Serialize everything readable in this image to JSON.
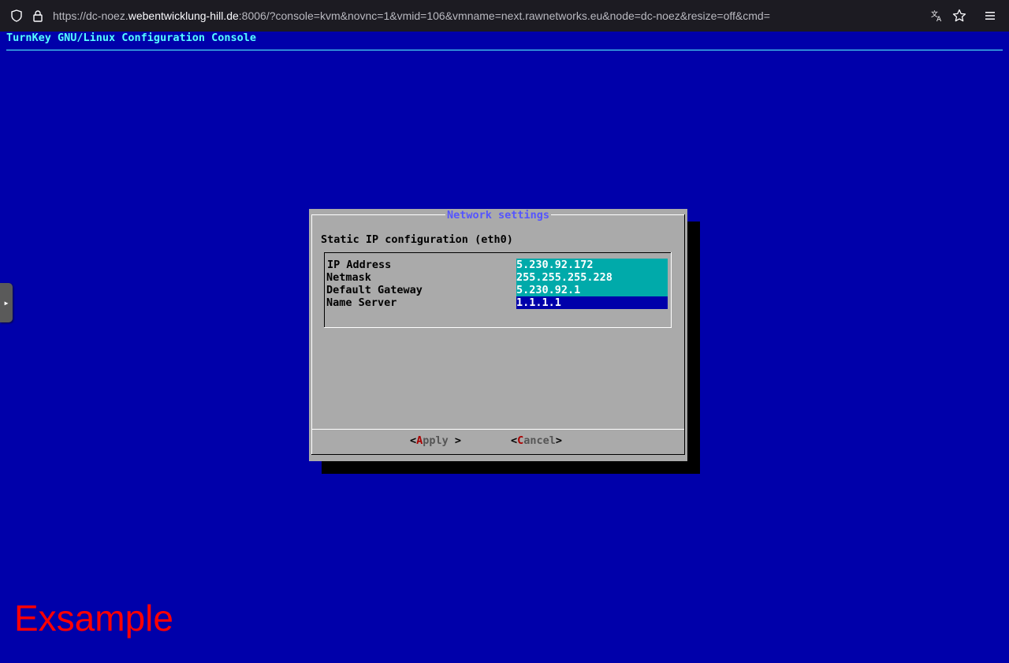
{
  "browser": {
    "url_prefix": "https://dc-noez.",
    "url_host": "webentwicklung-hill.de",
    "url_suffix": ":8006/?console=kvm&novnc=1&vmid=106&vmname=next.rawnetworks.eu&node=dc-noez&resize=off&cmd="
  },
  "console": {
    "title": "TurnKey GNU/Linux Configuration Console"
  },
  "dialog": {
    "title": "Network settings",
    "subtitle": "Static IP configuration (eth0)",
    "fields": [
      {
        "label": "IP Address",
        "value": "5.230.92.172"
      },
      {
        "label": "Netmask",
        "value": "255.255.255.228"
      },
      {
        "label": "Default Gateway",
        "value": "5.230.92.1"
      },
      {
        "label": "Name Server",
        "value": "1.1.1.1"
      }
    ],
    "buttons": {
      "apply": {
        "open": "<",
        "hotkey": "A",
        "rest": "pply",
        "close": " >"
      },
      "cancel": {
        "open": "<",
        "hotkey": "C",
        "rest": "ancel",
        "close": ">"
      }
    }
  },
  "watermark": "Exsample",
  "colors": {
    "console_bg": "#0000aa",
    "dialog_bg": "#aaaaaa",
    "field_bg": "#00aaaa",
    "title_cyan": "#55ffff",
    "watermark_red": "#ff0000"
  }
}
